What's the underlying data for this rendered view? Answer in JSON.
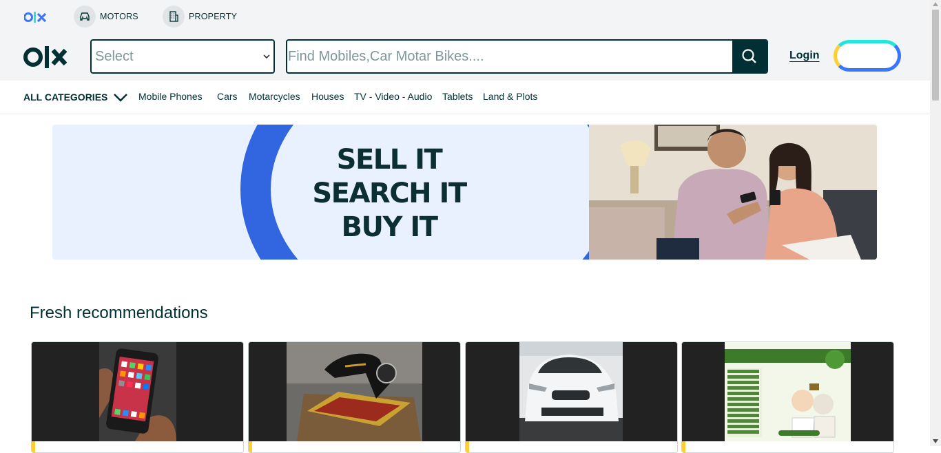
{
  "header": {
    "brand": "olx",
    "motors_label": "MOTORS",
    "property_label": "PROPERTY",
    "location_select": "Select",
    "search_placeholder": "Find Mobiles,Car Motar Bikes....",
    "login_label": "Login"
  },
  "categories": {
    "all_label": "ALL CATEGORIES",
    "items": [
      "Mobile Phones",
      "Cars",
      "Motarcycles",
      "Houses",
      "TV - Video - Audio",
      "Tablets",
      "Land & Plots"
    ]
  },
  "banner": {
    "lines": [
      "SELL IT",
      "SEARCH IT",
      "BUY IT"
    ]
  },
  "fresh": {
    "title": "Fresh recommendations"
  },
  "colors": {
    "primary": "#002f34",
    "accent_blue": "#3a77ff",
    "accent_teal": "#23e5db",
    "accent_yellow": "#ffce32"
  }
}
